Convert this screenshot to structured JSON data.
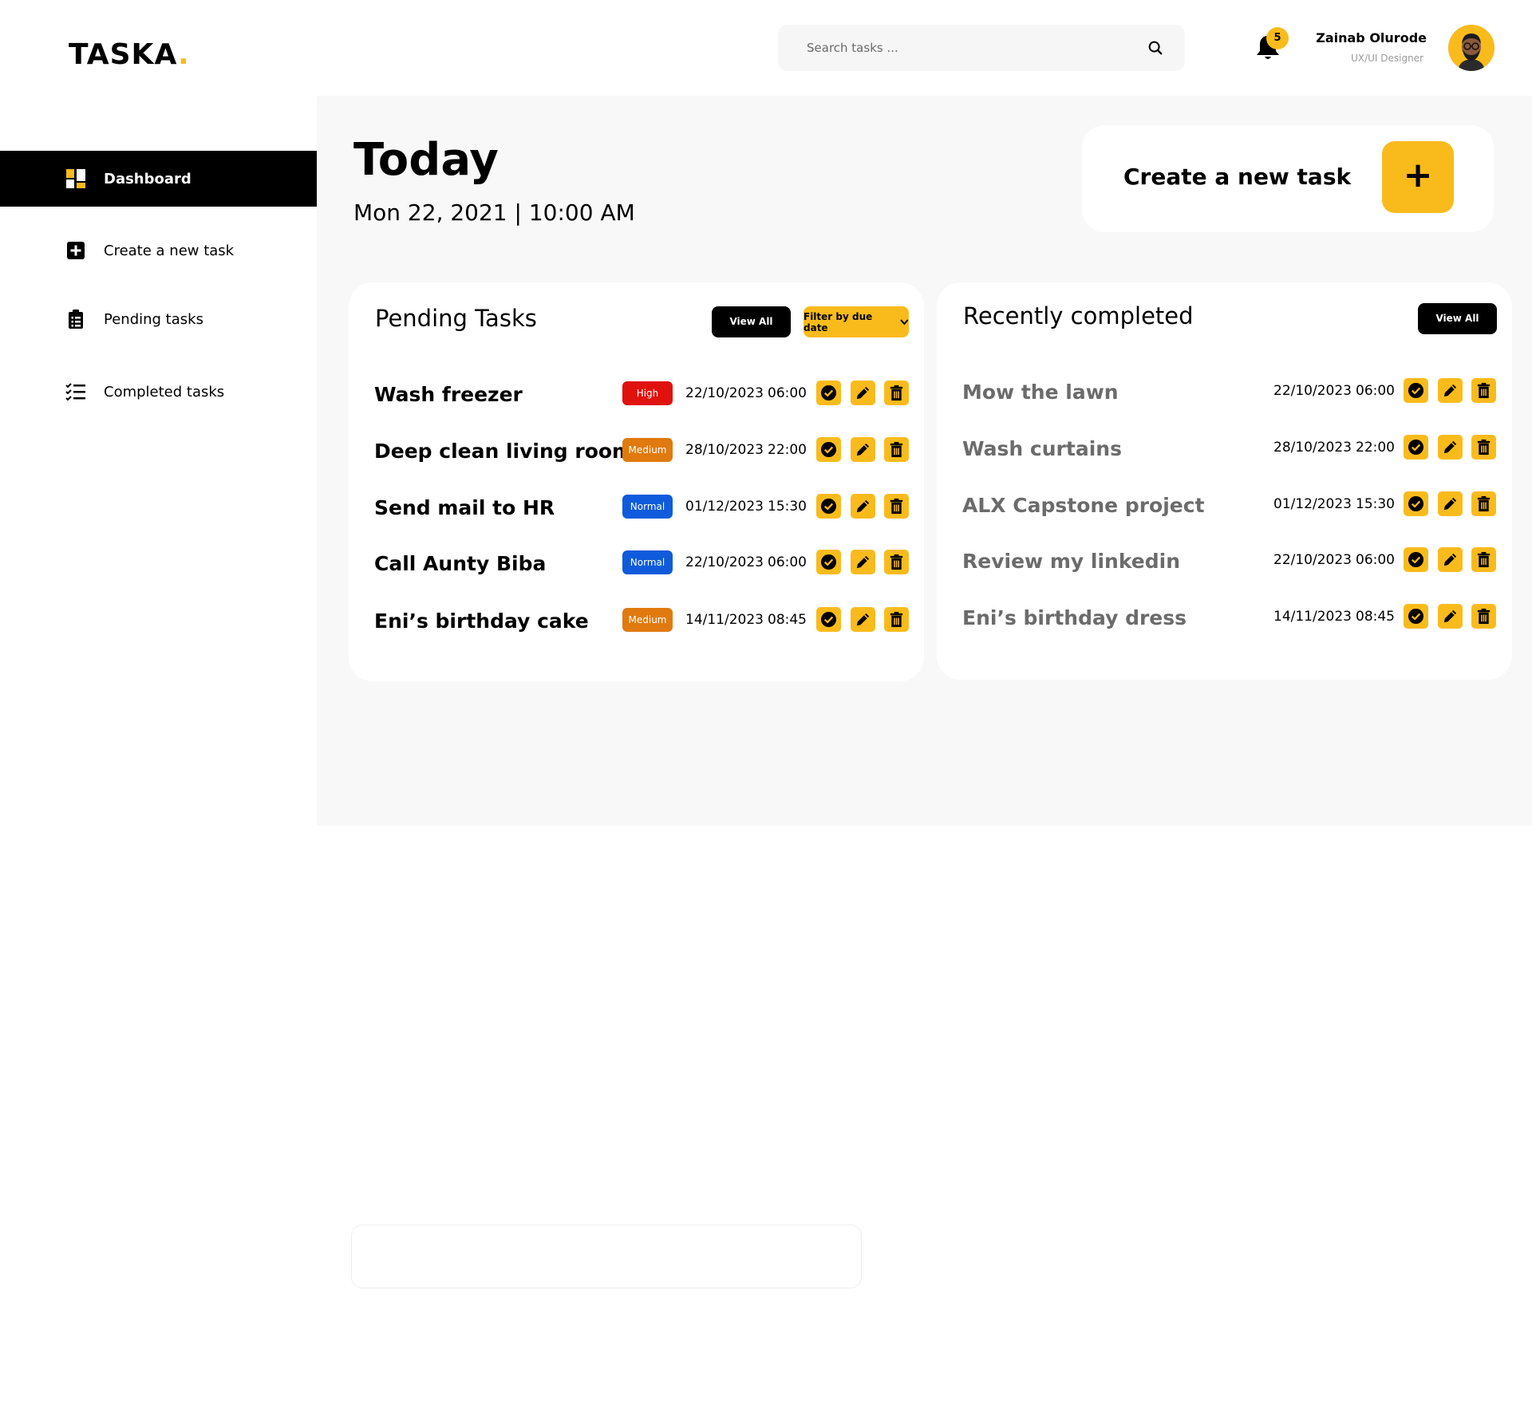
{
  "app": {
    "logo_text": "TASKA",
    "logo_dot": "."
  },
  "header": {
    "search_placeholder": "Search tasks ...",
    "notification_count": "5",
    "user_name": "Zainab Olurode",
    "user_role": "UX/UI Designer"
  },
  "sidebar": {
    "items": [
      {
        "label": "Dashboard",
        "icon": "dashboard-icon",
        "active": true
      },
      {
        "label": "Create a new task",
        "icon": "plus-square-icon",
        "active": false
      },
      {
        "label": "Pending tasks",
        "icon": "clipboard-icon",
        "active": false
      },
      {
        "label": "Completed tasks",
        "icon": "checklist-icon",
        "active": false
      }
    ]
  },
  "main": {
    "heading": "Today",
    "date_line": "Mon 22, 2021 | 10:00 AM",
    "create_card_label": "Create a new task",
    "create_card_button": "+"
  },
  "pending": {
    "title": "Pending Tasks",
    "view_all": "View All",
    "filter_label": "Filter by due date",
    "tasks": [
      {
        "name": "Wash freezer",
        "priority": "High",
        "date": "22/10/2023",
        "time": "06:00"
      },
      {
        "name": "Deep clean living room",
        "priority": "Medium",
        "date": "28/10/2023",
        "time": "22:00"
      },
      {
        "name": "Send mail to HR",
        "priority": "Normal",
        "date": "01/12/2023",
        "time": "15:30"
      },
      {
        "name": "Call Aunty Biba",
        "priority": "Normal",
        "date": "22/10/2023",
        "time": "06:00"
      },
      {
        "name": "Eni’s birthday cake",
        "priority": "Medium",
        "date": "14/11/2023",
        "time": "08:45"
      }
    ]
  },
  "completed": {
    "title": "Recently completed",
    "view_all": "View All",
    "tasks": [
      {
        "name": "Mow the lawn",
        "date": "22/10/2023",
        "time": "06:00"
      },
      {
        "name": "Wash curtains",
        "date": "28/10/2023",
        "time": "22:00"
      },
      {
        "name": "ALX Capstone project",
        "date": "01/12/2023",
        "time": "15:30"
      },
      {
        "name": "Review my linkedin",
        "date": "22/10/2023",
        "time": "06:00"
      },
      {
        "name": "Eni’s birthday dress",
        "date": "14/11/2023",
        "time": "08:45"
      }
    ]
  },
  "colors": {
    "accent": "#F9BB1C",
    "high": "#E0120E",
    "medium": "#E07A0E",
    "normal": "#0F5BDB",
    "main_bg": "#F8F8F8"
  }
}
